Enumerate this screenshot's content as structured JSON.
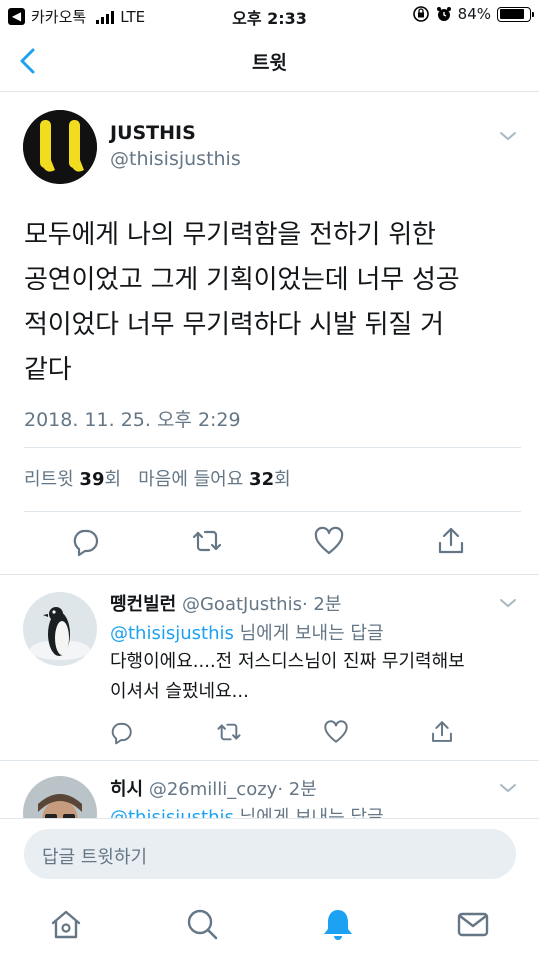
{
  "status_bar": {
    "carrier": "카카오톡",
    "network": "LTE",
    "time": "오후 2:33",
    "battery_percent": "84%",
    "battery_level": 0.84
  },
  "nav": {
    "title": "트윗"
  },
  "tweet": {
    "author_name": "JUSTHIS",
    "author_handle": "@thisisjusthis",
    "text_lines": [
      "모두에게 나의 무기력함을 전하기 위한",
      "공연이었고 그게 기획이었는데 너무 성공",
      "적이었다 너무 무기력하다 시발 뒤질 거",
      "같다"
    ],
    "timestamp": "2018. 11. 25. 오후 2:29",
    "retweets_label": "리트윗",
    "retweets_count": "39",
    "count_unit": "회",
    "likes_label": "마음에 들어요",
    "likes_count": "32"
  },
  "replies": [
    {
      "name": "뗑컨빌런",
      "handle": "@GoatJusthis",
      "age": "· 2분",
      "mention": "@thisisjusthis",
      "to_suffix": " 님에게 보내는 답글",
      "text_lines": [
        "다행이에요....전 저스디스님이 진짜 무기력해보",
        "이셔서 슬펐네요..."
      ]
    },
    {
      "name": "히시",
      "handle": "@26milli_cozy",
      "age": "· 2분",
      "mention": "@thisisjusthis",
      "to_suffix": " 님에게 보내는 답글"
    }
  ],
  "compose": {
    "placeholder": "답글 트윗하기"
  },
  "colors": {
    "accent": "#1da1f2",
    "muted": "#657786",
    "text": "#14171a",
    "border": "#e1e8ed"
  },
  "icons": [
    "back-chevron-icon",
    "caret-down-icon",
    "reply-icon",
    "retweet-icon",
    "like-icon",
    "share-icon",
    "home-icon",
    "search-icon",
    "notifications-icon",
    "messages-icon"
  ]
}
